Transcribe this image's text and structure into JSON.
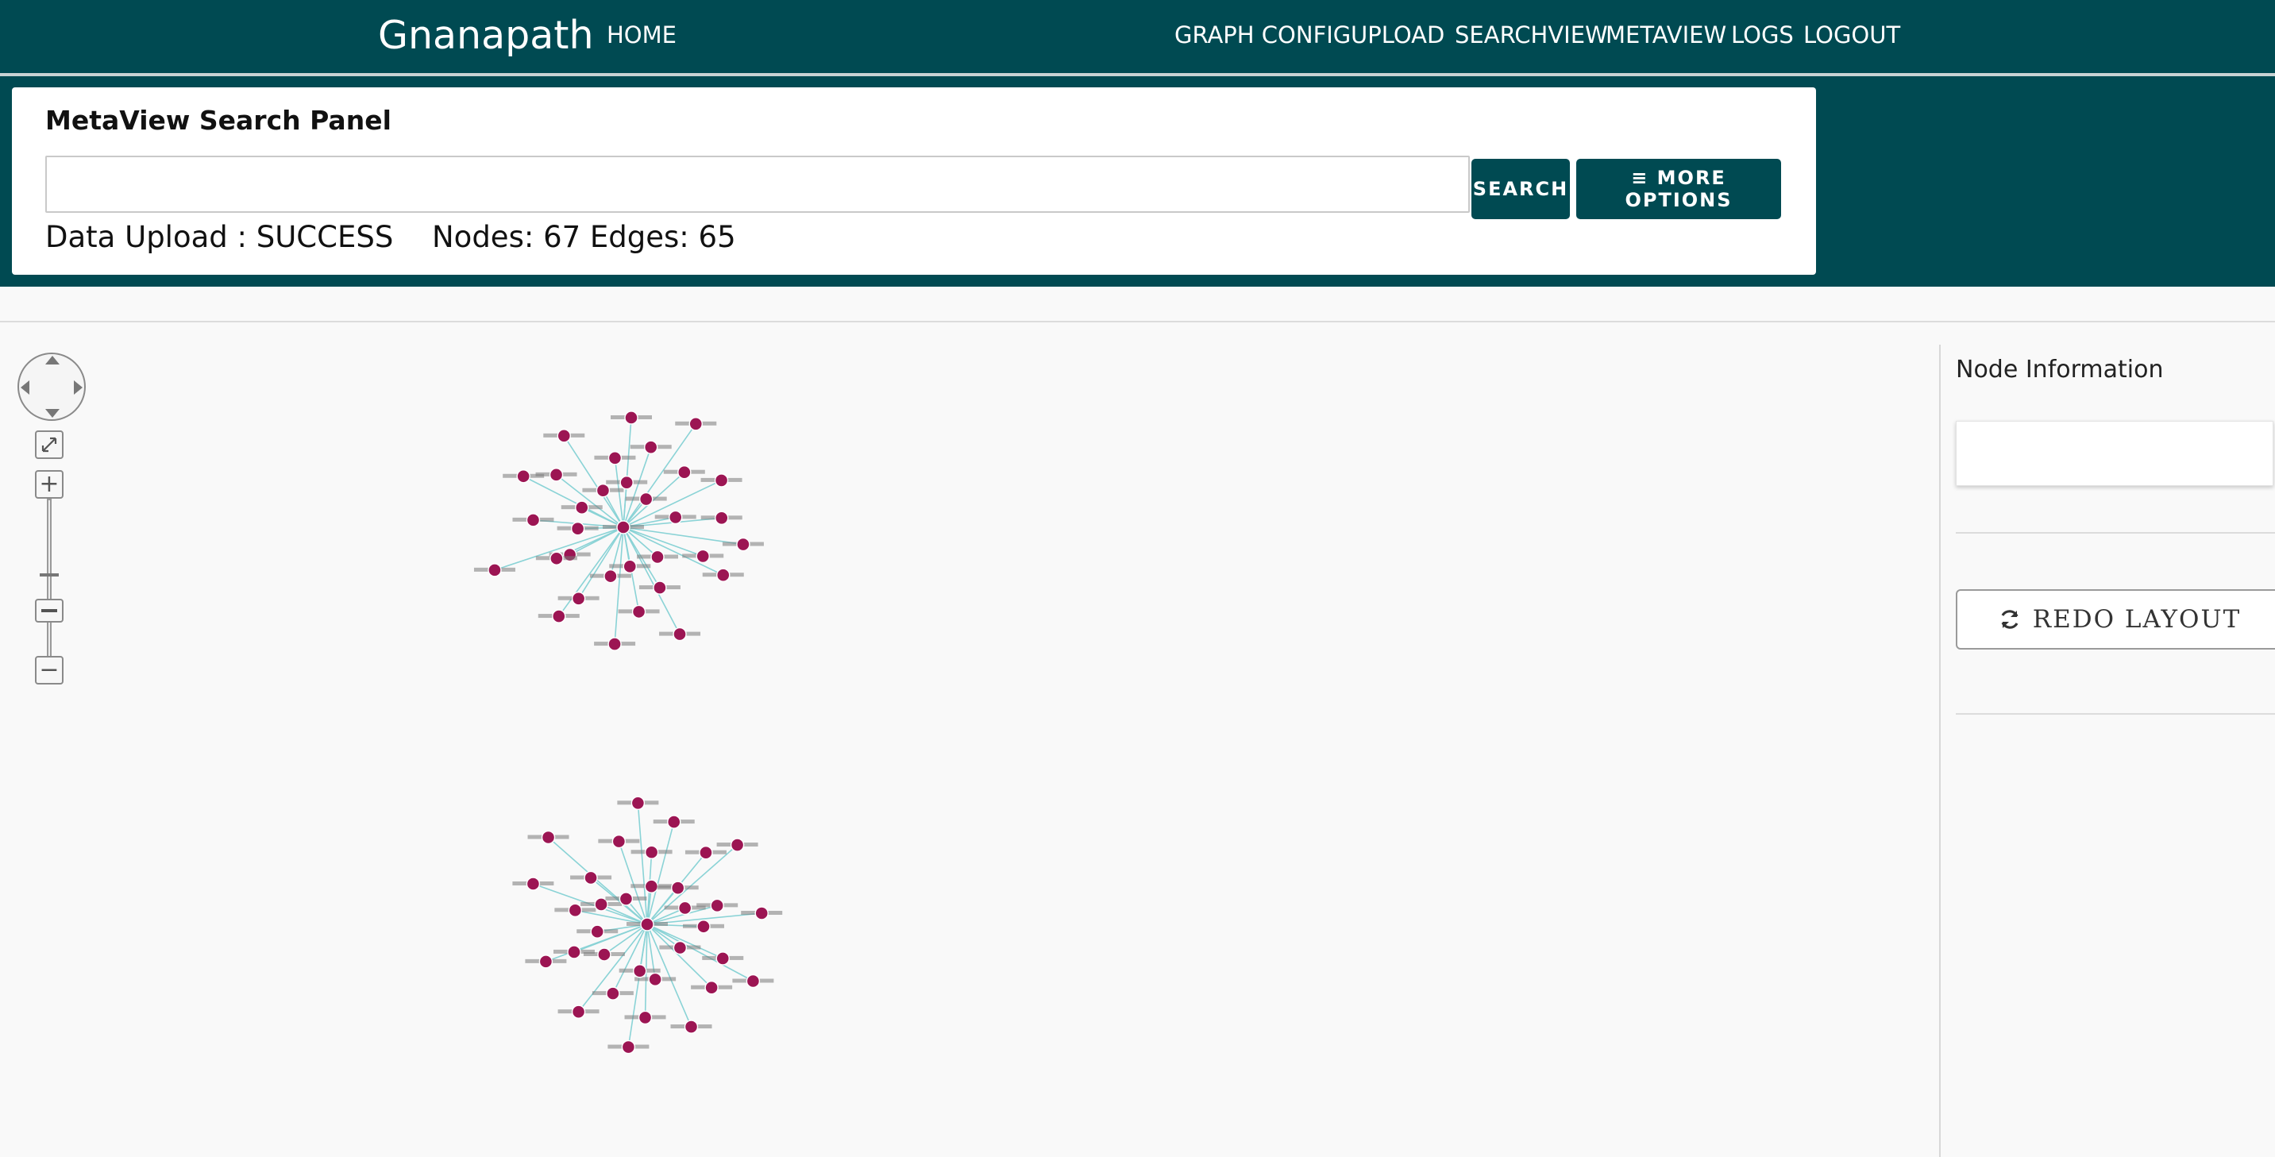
{
  "navbar": {
    "brand": "Gnanapath",
    "home": "HOME",
    "links": [
      "GRAPH CONFIG",
      "UPLOAD",
      "SEARCHVIEW",
      "METAVIEW",
      "LOGS",
      "LOGOUT"
    ]
  },
  "search_panel": {
    "title": "MetaView Search Panel",
    "input_value": "",
    "search_label": "SEARCH",
    "more_options_label": "≡ MORE OPTIONS",
    "upload_status": "Data Upload : SUCCESS",
    "counts": "Nodes: 67 Edges: 65"
  },
  "graph_controls": {
    "fit_icon": "expand-icon",
    "zoom_in": "+",
    "zoom_out": "−"
  },
  "sidebar": {
    "title": "Node Information",
    "redo_label": "REDO LAYOUT",
    "redo_icon": "refresh-icon"
  },
  "colors": {
    "primary": "#004a52",
    "node": "#9c1553",
    "edge": "#8ad3d6"
  }
}
